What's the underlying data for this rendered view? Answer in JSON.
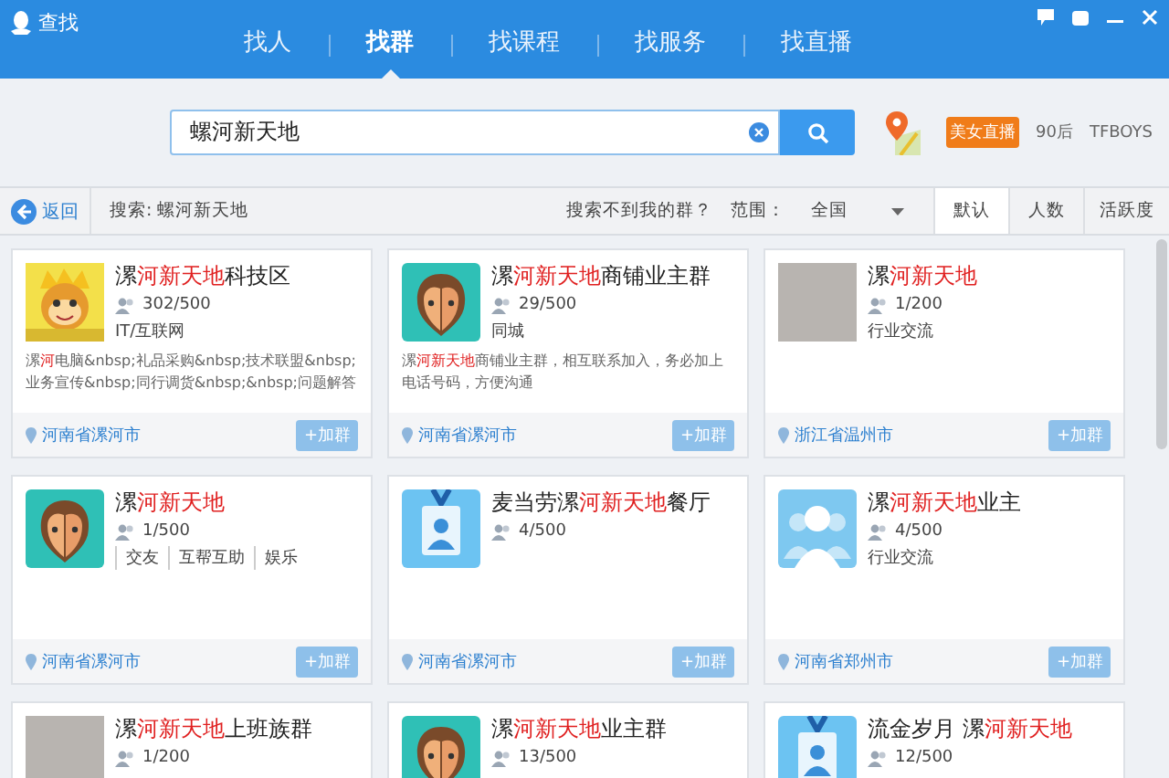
{
  "window": {
    "title": "查找"
  },
  "tabs": [
    {
      "label": "找人",
      "selected": false
    },
    {
      "label": "找群",
      "selected": true
    },
    {
      "label": "找课程",
      "selected": false
    },
    {
      "label": "找服务",
      "selected": false
    },
    {
      "label": "找直播",
      "selected": false
    }
  ],
  "search": {
    "value": "螺河新天地"
  },
  "hot_tags": [
    {
      "label": "美女直播",
      "kind": "badge"
    },
    {
      "label": "90后",
      "kind": "plain"
    },
    {
      "label": "TFBOYS",
      "kind": "plain"
    }
  ],
  "toolbar": {
    "back": "返回",
    "query": "搜索: 螺河新天地",
    "help_link": "搜索不到我的群？",
    "range_label": "范围：",
    "range_value": "全国",
    "sort_tabs": [
      {
        "label": "默认",
        "selected": true
      },
      {
        "label": "人数",
        "selected": false
      },
      {
        "label": "活跃度",
        "selected": false
      }
    ]
  },
  "groups": [
    {
      "kind": "cartoon-king",
      "name": [
        {
          "text": "漯",
          "highlight": false
        },
        {
          "text": "河新天地",
          "highlight": true
        },
        {
          "text": "科技区",
          "highlight": false
        }
      ],
      "members": "302/500",
      "category": "IT/互联网",
      "description": [
        {
          "text": "漯",
          "highlight": false
        },
        {
          "text": "河",
          "highlight": true
        },
        {
          "text": "电脑&nbsp;礼品采购&nbsp;技术联盟&nbsp;业务宣传&nbsp;同行调货&nbsp;&nbsp;问题解答",
          "highlight": false
        }
      ],
      "location": "河南省漯河市",
      "join": "+加群"
    },
    {
      "kind": "cartoon-face",
      "name": [
        {
          "text": "漯",
          "highlight": false
        },
        {
          "text": "河新天地",
          "highlight": true
        },
        {
          "text": "商铺业主群",
          "highlight": false
        }
      ],
      "members": "29/500",
      "category": "同城",
      "description": [
        {
          "text": "漯",
          "highlight": false
        },
        {
          "text": "河新天地",
          "highlight": true
        },
        {
          "text": "商铺业主群，相互联系加入，务必加上电话号码，方便沟通",
          "highlight": false
        }
      ],
      "location": "河南省漯河市",
      "join": "+加群"
    },
    {
      "kind": "photo",
      "name": [
        {
          "text": "漯",
          "highlight": false
        },
        {
          "text": "河新天地",
          "highlight": true
        }
      ],
      "members": "1/200",
      "category": "行业交流",
      "location": "浙江省温州市",
      "join": "+加群"
    },
    {
      "kind": "cartoon-face",
      "name": [
        {
          "text": "漯",
          "highlight": false
        },
        {
          "text": "河新天地",
          "highlight": true
        }
      ],
      "members": "1/500",
      "tags": [
        "交友",
        "互帮互助",
        "娱乐"
      ],
      "location": "河南省漯河市",
      "join": "+加群"
    },
    {
      "kind": "id-card",
      "name": [
        {
          "text": "麦当劳漯",
          "highlight": false
        },
        {
          "text": "河新天地",
          "highlight": true
        },
        {
          "text": "餐厅",
          "highlight": false
        }
      ],
      "members": "4/500",
      "location": "河南省漯河市",
      "join": "+加群"
    },
    {
      "kind": "people",
      "name": [
        {
          "text": "漯",
          "highlight": false
        },
        {
          "text": "河新天地",
          "highlight": true
        },
        {
          "text": "业主",
          "highlight": false
        }
      ],
      "members": "4/500",
      "category": "行业交流",
      "location": "河南省郑州市",
      "join": "+加群"
    },
    {
      "kind": "photo",
      "name": [
        {
          "text": "漯",
          "highlight": false
        },
        {
          "text": "河新天地",
          "highlight": true
        },
        {
          "text": "上班族群",
          "highlight": false
        }
      ],
      "members": "1/200"
    },
    {
      "kind": "cartoon-face",
      "name": [
        {
          "text": "漯",
          "highlight": false
        },
        {
          "text": "河新天地",
          "highlight": true
        },
        {
          "text": "业主群",
          "highlight": false
        }
      ],
      "members": "13/500"
    },
    {
      "kind": "id-card",
      "name": [
        {
          "text": "流金岁月 漯",
          "highlight": false
        },
        {
          "text": "河新天地",
          "highlight": true
        }
      ],
      "members": "12/500"
    }
  ]
}
